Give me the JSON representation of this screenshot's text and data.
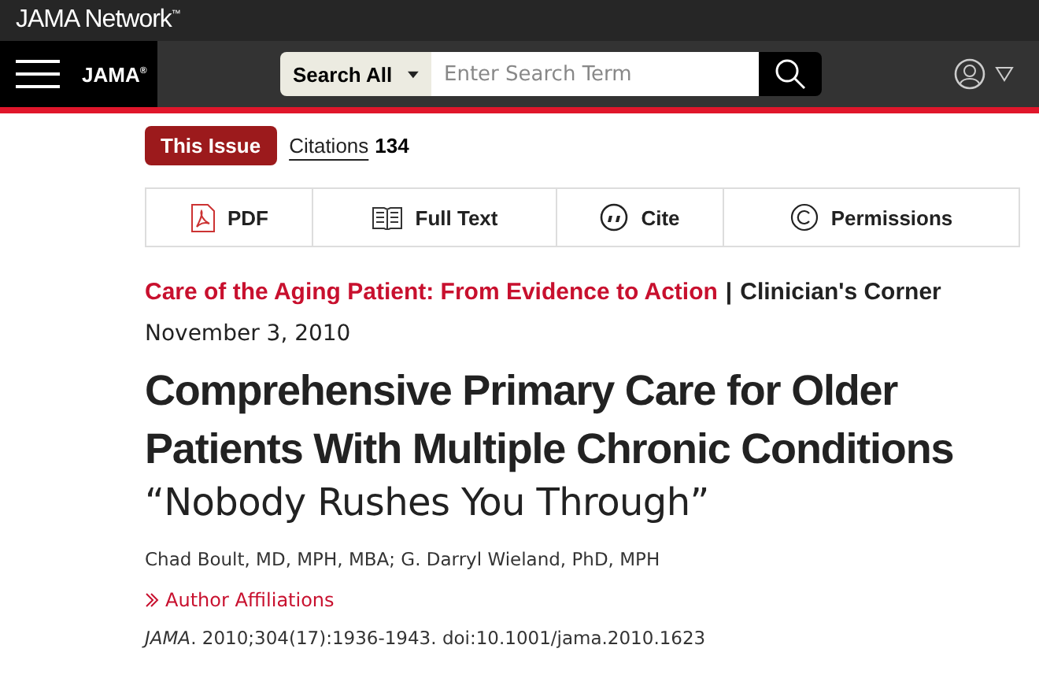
{
  "network_bar": {
    "logo": "JAMA Network",
    "trademark": "™"
  },
  "header": {
    "logo": "JAMA",
    "registered": "®",
    "search": {
      "scope": "Search All",
      "placeholder": "Enter Search Term"
    }
  },
  "tabs": [
    {
      "label": "This Issue",
      "selected": true
    },
    {
      "label": "Citations",
      "count": "134",
      "selected": false
    }
  ],
  "actions": [
    {
      "kind": "pdf",
      "label": "PDF"
    },
    {
      "kind": "fulltext",
      "label": "Full Text"
    },
    {
      "kind": "cite",
      "label": "Cite"
    },
    {
      "kind": "permissions",
      "label": "Permissions"
    }
  ],
  "article": {
    "series": "Care of the Aging Patient: From Evidence to Action",
    "separator": "|",
    "section": "Clinician's Corner",
    "date": "November 3, 2010",
    "title": "Comprehensive Primary Care for Older Patients With Multiple Chronic Conditions",
    "subtitle": "“Nobody Rushes You Through”",
    "authors": "Chad Boult, MD, MPH, MBA; G. Darryl Wieland, PhD, MPH",
    "affiliations_link": "Author Affiliations",
    "citation": "*JAMA*. 2010;304(17):1936-1943. doi:10.1001/jama.2010.1623"
  }
}
